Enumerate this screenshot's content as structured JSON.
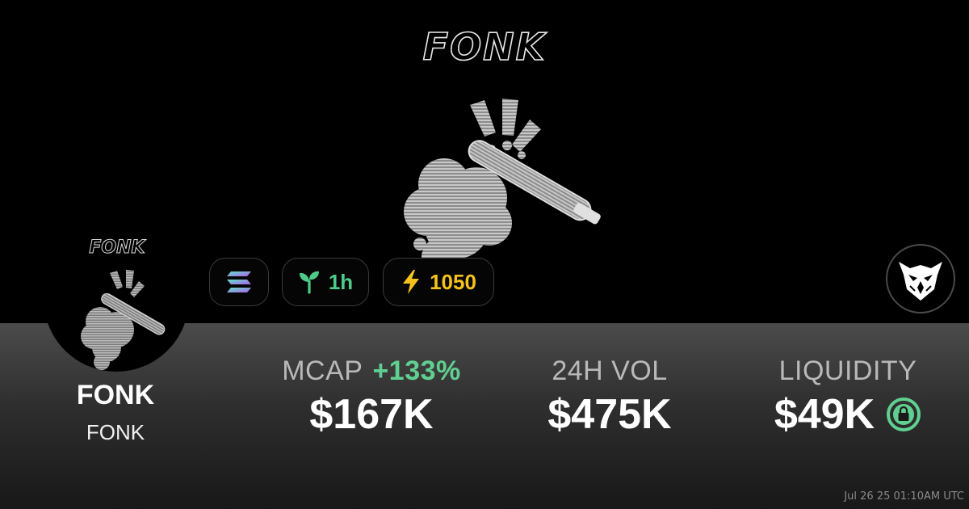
{
  "hero": {
    "logo_text": "FONK"
  },
  "token": {
    "name": "FONK",
    "symbol": "FONK",
    "avatar_logo_text": "FONK"
  },
  "pills": {
    "chain_icon": "solana-icon",
    "age_icon": "sprout-icon",
    "age_label": "1h",
    "boost_icon": "lightning-icon",
    "boost_value": "1050"
  },
  "badge": {
    "icon": "owl-icon"
  },
  "stats": {
    "mcap_label": "MCAP",
    "mcap_change": "+133%",
    "mcap_value": "$167K",
    "vol_label": "24H VOL",
    "vol_value": "$475K",
    "liq_label": "LIQUIDITY",
    "liq_value": "$49K",
    "liq_icon": "lock-icon"
  },
  "footer": {
    "timestamp": "Jul 26 25 01:10AM UTC"
  },
  "colors": {
    "green": "#5fd08f",
    "yellow": "#f5c21b",
    "panel_top": "#4b4b4b",
    "panel_bottom": "#181818"
  }
}
